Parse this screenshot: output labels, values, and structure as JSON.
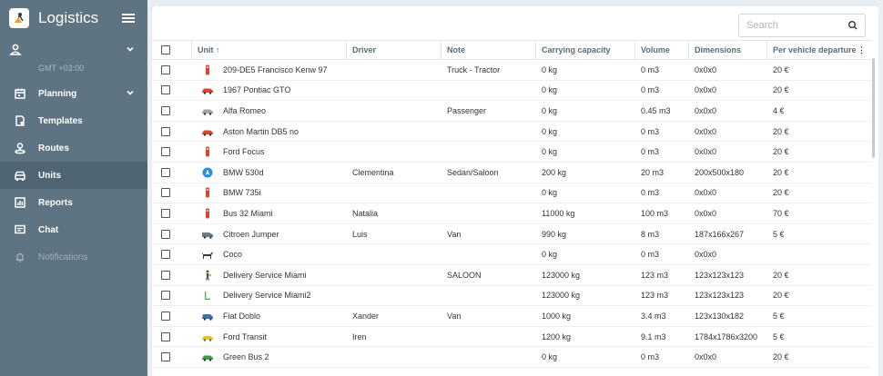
{
  "brand": {
    "title": "Logistics"
  },
  "sidebar": {
    "timezone": "GMT +03:00",
    "items": [
      {
        "label": "Planning",
        "icon": "calendar-icon"
      },
      {
        "label": "Templates",
        "icon": "template-icon"
      },
      {
        "label": "Routes",
        "icon": "routes-icon"
      },
      {
        "label": "Units",
        "icon": "car-icon"
      },
      {
        "label": "Reports",
        "icon": "reports-icon"
      },
      {
        "label": "Chat",
        "icon": "chat-icon"
      },
      {
        "label": "Notifications",
        "icon": "bell-icon"
      }
    ]
  },
  "search": {
    "placeholder": "Search"
  },
  "table": {
    "columns": [
      "Unit ↑",
      "Driver",
      "Note",
      "Carrying capacity",
      "Volume",
      "Dimensions",
      "Per vehicle departure"
    ],
    "rows": [
      {
        "unit": "209-DE5 Francisco Kenw 97",
        "driver": "",
        "note": "Truck - Tractor",
        "capacity": "0 kg",
        "volume": "0 m3",
        "dimensions": "0x0x0",
        "departure": "20 €",
        "icon": "red-truck-icon"
      },
      {
        "unit": "1967 Pontiac GTO",
        "driver": "",
        "note": "",
        "capacity": "0 kg",
        "volume": "0 m3",
        "dimensions": "0x0x0",
        "departure": "20 €",
        "icon": "red-car-icon"
      },
      {
        "unit": "Alfa Romeo",
        "driver": "",
        "note": "Passenger",
        "capacity": "0 kg",
        "volume": "0.45 m3",
        "dimensions": "0x0x0",
        "departure": "4 €",
        "icon": "silver-car-icon"
      },
      {
        "unit": "Aston Martin DB5 no",
        "driver": "",
        "note": "",
        "capacity": "0 kg",
        "volume": "0 m3",
        "dimensions": "0x0x0",
        "departure": "20 €",
        "icon": "red-car-icon"
      },
      {
        "unit": "Ford Focus",
        "driver": "",
        "note": "",
        "capacity": "0 kg",
        "volume": "0 m3",
        "dimensions": "0x0x0",
        "departure": "20 €",
        "icon": "red-truck-icon"
      },
      {
        "unit": "BMW 530d",
        "driver": "Clementina",
        "note": "Sedan/Saloon",
        "capacity": "200 kg",
        "volume": "20 m3",
        "dimensions": "200x500x180",
        "departure": "20 €",
        "icon": "navigation-icon"
      },
      {
        "unit": "BMW 735i",
        "driver": "",
        "note": "",
        "capacity": "0 kg",
        "volume": "0 m3",
        "dimensions": "0x0x0",
        "departure": "20 €",
        "icon": "red-truck-icon"
      },
      {
        "unit": "Bus 32 Miami",
        "driver": "Natalia",
        "note": "",
        "capacity": "11000 kg",
        "volume": "100 m3",
        "dimensions": "0x0x0",
        "departure": "70 €",
        "icon": "red-truck-icon"
      },
      {
        "unit": "Citroen Jumper",
        "driver": "Luis",
        "note": "Van",
        "capacity": "990 kg",
        "volume": "8 m3",
        "dimensions": "187x166x267",
        "departure": "5 €",
        "icon": "gray-van-icon"
      },
      {
        "unit": "Coco",
        "driver": "",
        "note": "",
        "capacity": "0 kg",
        "volume": "0 m3",
        "dimensions": "0x0x0",
        "departure": "",
        "icon": "dog-icon"
      },
      {
        "unit": "Delivery Service Miami",
        "driver": "",
        "note": "SALOON",
        "capacity": "123000 kg",
        "volume": "123 m3",
        "dimensions": "123x123x123",
        "departure": "20 €",
        "icon": "courier-icon"
      },
      {
        "unit": "Delivery Service Miami2",
        "driver": "",
        "note": "",
        "capacity": "123000 kg",
        "volume": "123 m3",
        "dimensions": "123x123x123",
        "departure": "20 €",
        "icon": "green-corner-icon"
      },
      {
        "unit": "Fiat Doblo",
        "driver": "Xander",
        "note": "Van",
        "capacity": "1000 kg",
        "volume": "3.4 m3",
        "dimensions": "123x130x182",
        "departure": "5 €",
        "icon": "blue-van-icon"
      },
      {
        "unit": "Ford Transit",
        "driver": "Iren",
        "note": "",
        "capacity": "1200 kg",
        "volume": "9.1 m3",
        "dimensions": "1784x1786x3200",
        "departure": "5 €",
        "icon": "yellow-car-icon"
      },
      {
        "unit": "Green Bus 2",
        "driver": "",
        "note": "",
        "capacity": "0 kg",
        "volume": "0 m3",
        "dimensions": "0x0x0",
        "departure": "20 €",
        "icon": "green-car-icon"
      }
    ]
  }
}
